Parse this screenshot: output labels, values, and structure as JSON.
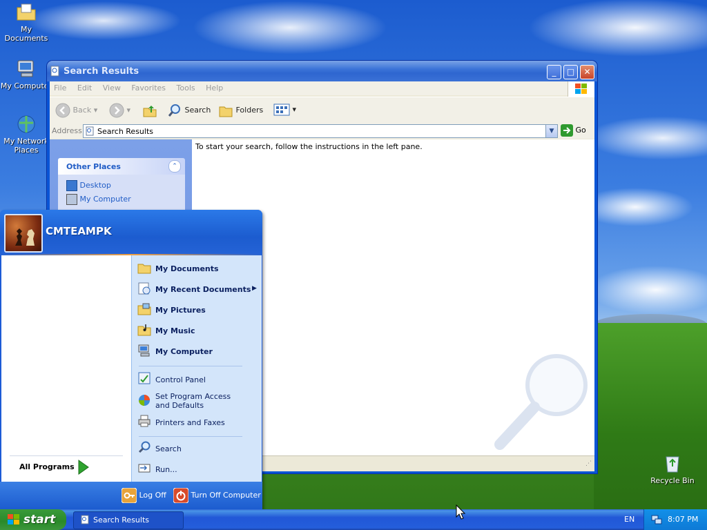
{
  "desktop": {
    "icons": [
      {
        "label": "My Documents",
        "icon": "folder-documents-icon"
      },
      {
        "label": "My Computer",
        "icon": "computer-icon"
      },
      {
        "label": "My Network Places",
        "icon": "network-places-icon"
      },
      {
        "label": "Recycle Bin",
        "icon": "recycle-bin-icon"
      }
    ]
  },
  "window": {
    "title": "Search Results",
    "menu": [
      "File",
      "Edit",
      "View",
      "Favorites",
      "Tools",
      "Help"
    ],
    "toolbar": {
      "back": "Back",
      "search": "Search",
      "folders": "Folders"
    },
    "address": {
      "label": "Address",
      "value": "Search Results",
      "go": "Go"
    },
    "left_pane": {
      "section_title": "Other Places",
      "items": [
        "Desktop",
        "My Computer"
      ]
    },
    "content_text": "To start your search, follow the instructions in the left pane."
  },
  "start_menu": {
    "user": "CMTEAMPK",
    "all_programs": "All Programs",
    "right_items": [
      {
        "label": "My Documents",
        "bold": true,
        "icon": "folder-documents-icon"
      },
      {
        "label": "My Recent Documents",
        "bold": true,
        "icon": "recent-documents-icon"
      },
      {
        "label": "My Pictures",
        "bold": true,
        "icon": "folder-pictures-icon"
      },
      {
        "label": "My Music",
        "bold": true,
        "icon": "folder-music-icon"
      },
      {
        "label": "My Computer",
        "bold": true,
        "icon": "computer-icon"
      },
      {
        "label": "Control Panel",
        "bold": false,
        "icon": "control-panel-icon"
      },
      {
        "label": "Set Program Access and Defaults",
        "bold": false,
        "icon": "program-access-icon"
      },
      {
        "label": "Printers and Faxes",
        "bold": false,
        "icon": "printer-icon"
      },
      {
        "label": "Search",
        "bold": false,
        "icon": "search-icon"
      },
      {
        "label": "Run...",
        "bold": false,
        "icon": "run-icon"
      }
    ],
    "log_off": "Log Off",
    "turn_off": "Turn Off Computer"
  },
  "taskbar": {
    "start": "start",
    "task": "Search Results",
    "language": "EN",
    "time": "8:07 PM"
  },
  "colors": {
    "title_bar": "#3c74d8",
    "start_button": "#2f8f2f",
    "taskbar": "#245edb",
    "menu_right_pane": "#d3e5fa"
  }
}
